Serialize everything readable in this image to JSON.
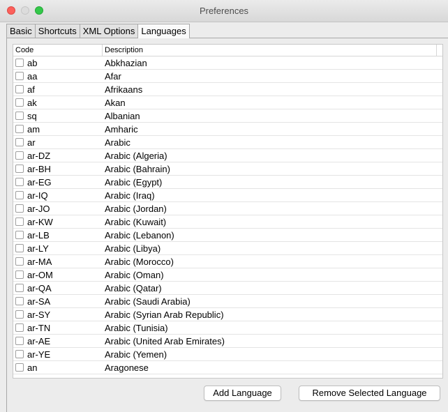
{
  "window": {
    "title": "Preferences"
  },
  "tabs": [
    {
      "label": "Basic"
    },
    {
      "label": "Shortcuts"
    },
    {
      "label": "XML Options"
    },
    {
      "label": "Languages",
      "active": true
    }
  ],
  "table": {
    "columns": {
      "code": "Code",
      "description": "Description"
    },
    "rows": [
      {
        "code": "ab",
        "description": "Abkhazian",
        "checked": false
      },
      {
        "code": "aa",
        "description": "Afar",
        "checked": false
      },
      {
        "code": "af",
        "description": "Afrikaans",
        "checked": false
      },
      {
        "code": "ak",
        "description": "Akan",
        "checked": false
      },
      {
        "code": "sq",
        "description": "Albanian",
        "checked": false
      },
      {
        "code": "am",
        "description": "Amharic",
        "checked": false
      },
      {
        "code": "ar",
        "description": "Arabic",
        "checked": false
      },
      {
        "code": "ar-DZ",
        "description": "Arabic (Algeria)",
        "checked": false
      },
      {
        "code": "ar-BH",
        "description": "Arabic (Bahrain)",
        "checked": false
      },
      {
        "code": "ar-EG",
        "description": "Arabic (Egypt)",
        "checked": false
      },
      {
        "code": "ar-IQ",
        "description": "Arabic (Iraq)",
        "checked": false
      },
      {
        "code": "ar-JO",
        "description": "Arabic (Jordan)",
        "checked": false
      },
      {
        "code": "ar-KW",
        "description": "Arabic (Kuwait)",
        "checked": false
      },
      {
        "code": "ar-LB",
        "description": "Arabic (Lebanon)",
        "checked": false
      },
      {
        "code": "ar-LY",
        "description": "Arabic (Libya)",
        "checked": false
      },
      {
        "code": "ar-MA",
        "description": "Arabic (Morocco)",
        "checked": false
      },
      {
        "code": "ar-OM",
        "description": "Arabic (Oman)",
        "checked": false
      },
      {
        "code": "ar-QA",
        "description": "Arabic (Qatar)",
        "checked": false
      },
      {
        "code": "ar-SA",
        "description": "Arabic (Saudi Arabia)",
        "checked": false
      },
      {
        "code": "ar-SY",
        "description": "Arabic (Syrian Arab Republic)",
        "checked": false
      },
      {
        "code": "ar-TN",
        "description": "Arabic (Tunisia)",
        "checked": false
      },
      {
        "code": "ar-AE",
        "description": "Arabic (United Arab Emirates)",
        "checked": false
      },
      {
        "code": "ar-YE",
        "description": "Arabic (Yemen)",
        "checked": false
      },
      {
        "code": "an",
        "description": "Aragonese",
        "checked": false
      }
    ]
  },
  "buttons": {
    "add": "Add Language",
    "remove": "Remove Selected Language"
  }
}
